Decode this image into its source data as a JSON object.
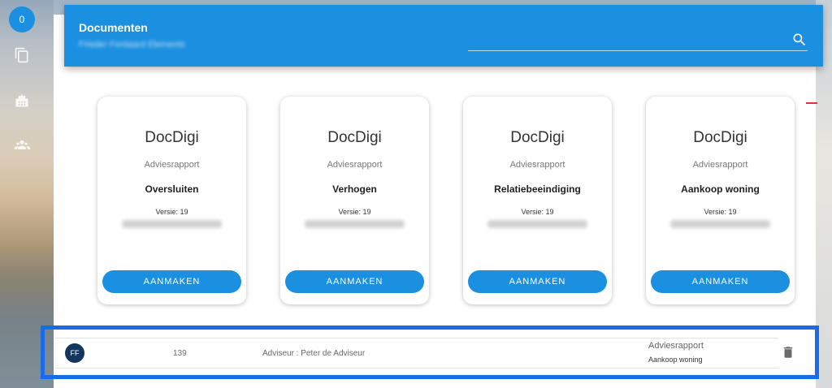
{
  "sidebar": {
    "badge_count": "0",
    "icons": [
      "document-icon",
      "building-icon",
      "people-icon"
    ]
  },
  "header": {
    "title": "Documenten",
    "subtitle": "Frieder Fontaard Elements",
    "search_placeholder": ""
  },
  "cards": [
    {
      "brand": "DocDigi",
      "type": "Adviesrapport",
      "name": "Oversluiten",
      "version": "Versie: 19",
      "button": "AANMAKEN"
    },
    {
      "brand": "DocDigi",
      "type": "Adviesrapport",
      "name": "Verhogen",
      "version": "Versie: 19",
      "button": "AANMAKEN"
    },
    {
      "brand": "DocDigi",
      "type": "Adviesrapport",
      "name": "Relatiebeeindiging",
      "version": "Versie: 19",
      "button": "AANMAKEN"
    },
    {
      "brand": "DocDigi",
      "type": "Adviesrapport",
      "name": "Aankoop woning",
      "version": "Versie: 19",
      "button": "AANMAKEN"
    }
  ],
  "document_row": {
    "initials": "FF",
    "number": "139",
    "advisor": "Adviseur : Peter de Adviseur",
    "type": "Adviesrapport",
    "name": "Aankoop woning"
  },
  "colors": {
    "accent": "#1b8fe0",
    "highlight": "#1a6be8",
    "avatar": "#13365d"
  }
}
